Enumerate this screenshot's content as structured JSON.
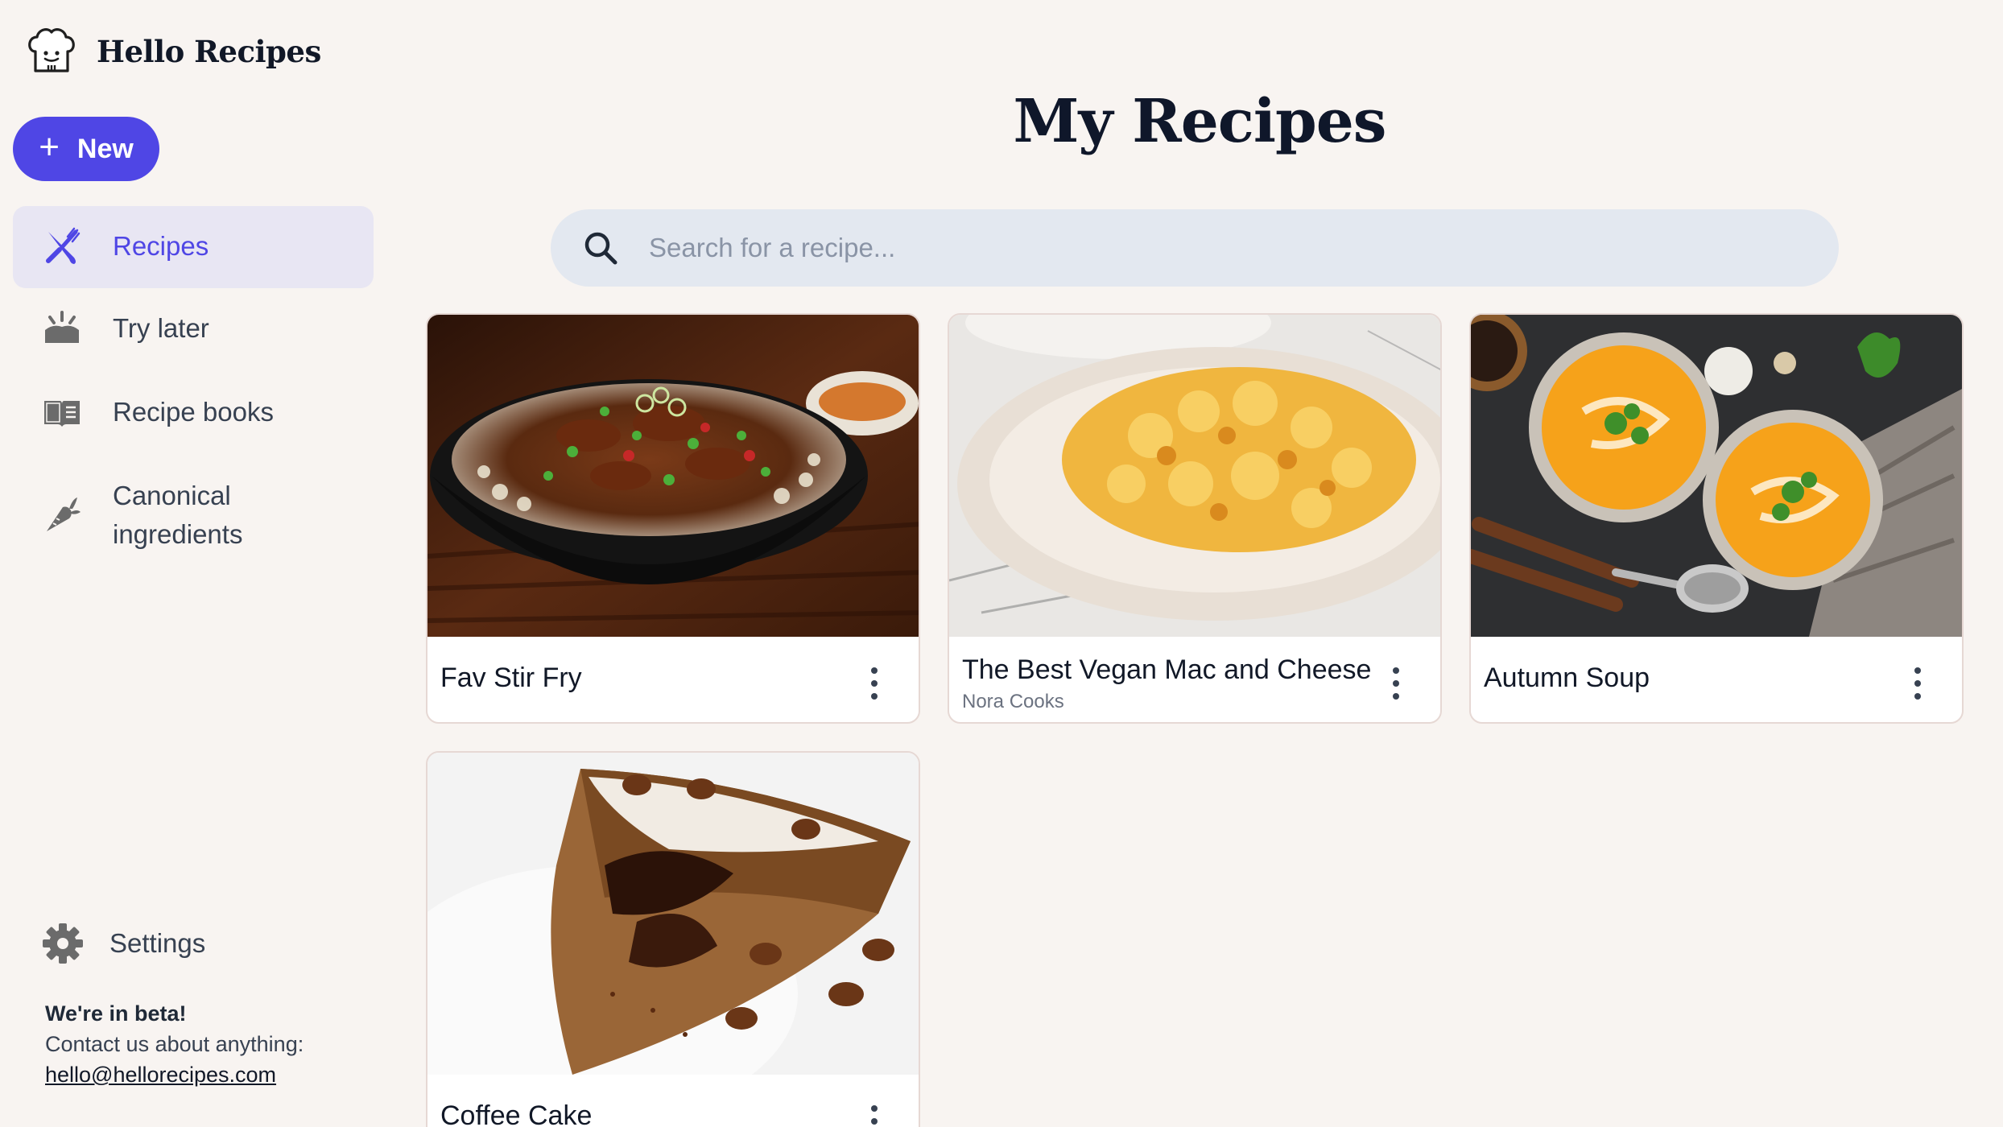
{
  "app": {
    "name": "Hello Recipes"
  },
  "new_button": {
    "label": "New"
  },
  "nav": {
    "items": [
      {
        "label": "Recipes",
        "icon": "utensils-crossed-icon",
        "active": true
      },
      {
        "label": "Try later",
        "icon": "try-later-icon",
        "active": false
      },
      {
        "label": "Recipe books",
        "icon": "book-icon",
        "active": false
      },
      {
        "label": "Canonical ingredients",
        "icon": "carrot-icon",
        "active": false
      }
    ]
  },
  "settings": {
    "label": "Settings",
    "icon": "gear-icon"
  },
  "beta": {
    "title": "We're in beta!",
    "text": "Contact us about anything:",
    "email": "hello@hellorecipes.com"
  },
  "page": {
    "title": "My Recipes"
  },
  "search": {
    "placeholder": "Search for a recipe...",
    "value": ""
  },
  "recipes": [
    {
      "name": "Fav Stir Fry",
      "source": ""
    },
    {
      "name": "The Best Vegan Mac and Cheese",
      "source": "Nora Cooks"
    },
    {
      "name": "Autumn Soup",
      "source": ""
    },
    {
      "name": "Coffee Cake",
      "source": ""
    }
  ],
  "colors": {
    "accent": "#4f46e5",
    "background": "#f8f4f1",
    "active_nav_bg": "#e8e6f3",
    "search_bg": "#e3e8f0"
  }
}
